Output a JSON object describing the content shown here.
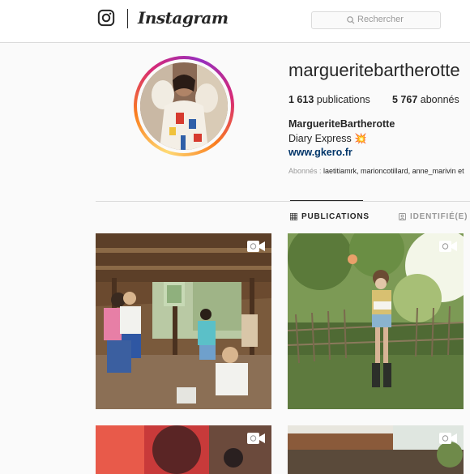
{
  "header": {
    "brand": "Instagram",
    "search_placeholder": "Rechercher"
  },
  "profile": {
    "username": "margueritebartherotte",
    "posts_count": "1 613",
    "posts_label": "publications",
    "followers_count": "5 767",
    "followers_label": "abonnés",
    "full_name": "MargueriteBartherotte",
    "bio": "Diary Express 💥",
    "website": "www.gkero.fr",
    "followed_by_label": "Abonnés :",
    "followed_by_names": "laetitiamrk, marioncotillard, anne_marivin et"
  },
  "tabs": {
    "publications": "PUBLICATIONS",
    "tagged": "IDENTIFIÉ(E)"
  },
  "icons": [
    "instagram-glyph-icon",
    "search-icon",
    "grid-icon",
    "tagged-icon",
    "video-icon"
  ],
  "colors": {
    "link": "#003569",
    "muted": "#999999",
    "border": "#dbdbdb"
  }
}
